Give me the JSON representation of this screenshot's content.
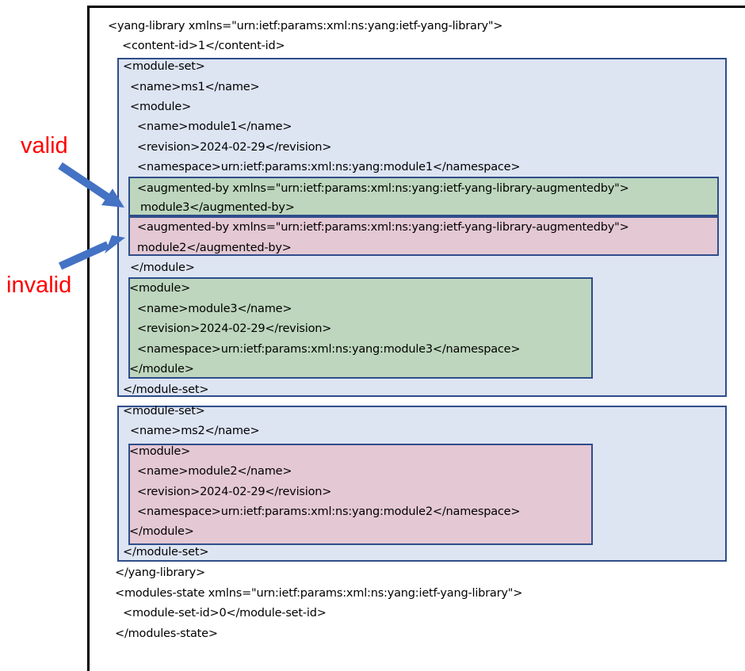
{
  "labels": {
    "valid": "valid",
    "invalid": "invalid"
  },
  "colors": {
    "label_red": "#ff0000",
    "box_border": "#2f4d8a",
    "module_set_fill": "#dde4f2",
    "valid_fill": "#bdd6bd",
    "invalid_fill": "#e4c8d4",
    "arrow": "#4472c4"
  },
  "xml": {
    "yang_library_open": "<yang-library xmlns=\"urn:ietf:params:xml:ns:yang:ietf-yang-library\">",
    "content_id": "<content-id>1</content-id>",
    "ms1": {
      "open": "<module-set>",
      "name": "<name>ms1</name>",
      "module1": {
        "open": "<module>",
        "name": "<name>module1</name>",
        "revision": "<revision>2024-02-29</revision>",
        "namespace": "<namespace>urn:ietf:params:xml:ns:yang:module1</namespace>",
        "augmented_valid_1": "<augmented-by xmlns=\"urn:ietf:params:xml:ns:yang:ietf-yang-library-augmentedby\">",
        "augmented_valid_2": "module3</augmented-by>",
        "augmented_invalid_1": "<augmented-by xmlns=\"urn:ietf:params:xml:ns:yang:ietf-yang-library-augmentedby\">",
        "augmented_invalid_2": "module2</augmented-by>",
        "close": "</module>"
      },
      "module3": {
        "open": "<module>",
        "name": "<name>module3</name>",
        "revision": "<revision>2024-02-29</revision>",
        "namespace": "<namespace>urn:ietf:params:xml:ns:yang:module3</namespace>",
        "close": "</module>"
      },
      "close": "</module-set>"
    },
    "ms2": {
      "open": "<module-set>",
      "name": "<name>ms2</name>",
      "module2": {
        "open": "<module>",
        "name": "<name>module2</name>",
        "revision": "<revision>2024-02-29</revision>",
        "namespace": "<namespace>urn:ietf:params:xml:ns:yang:module2</namespace>",
        "close": "</module>"
      },
      "close": "</module-set>"
    },
    "yang_library_close": "</yang-library>",
    "modules_state_open": "<modules-state xmlns=\"urn:ietf:params:xml:ns:yang:ietf-yang-library\">",
    "module_set_id": "<module-set-id>0</module-set-id>",
    "modules_state_close": "</modules-state>"
  }
}
